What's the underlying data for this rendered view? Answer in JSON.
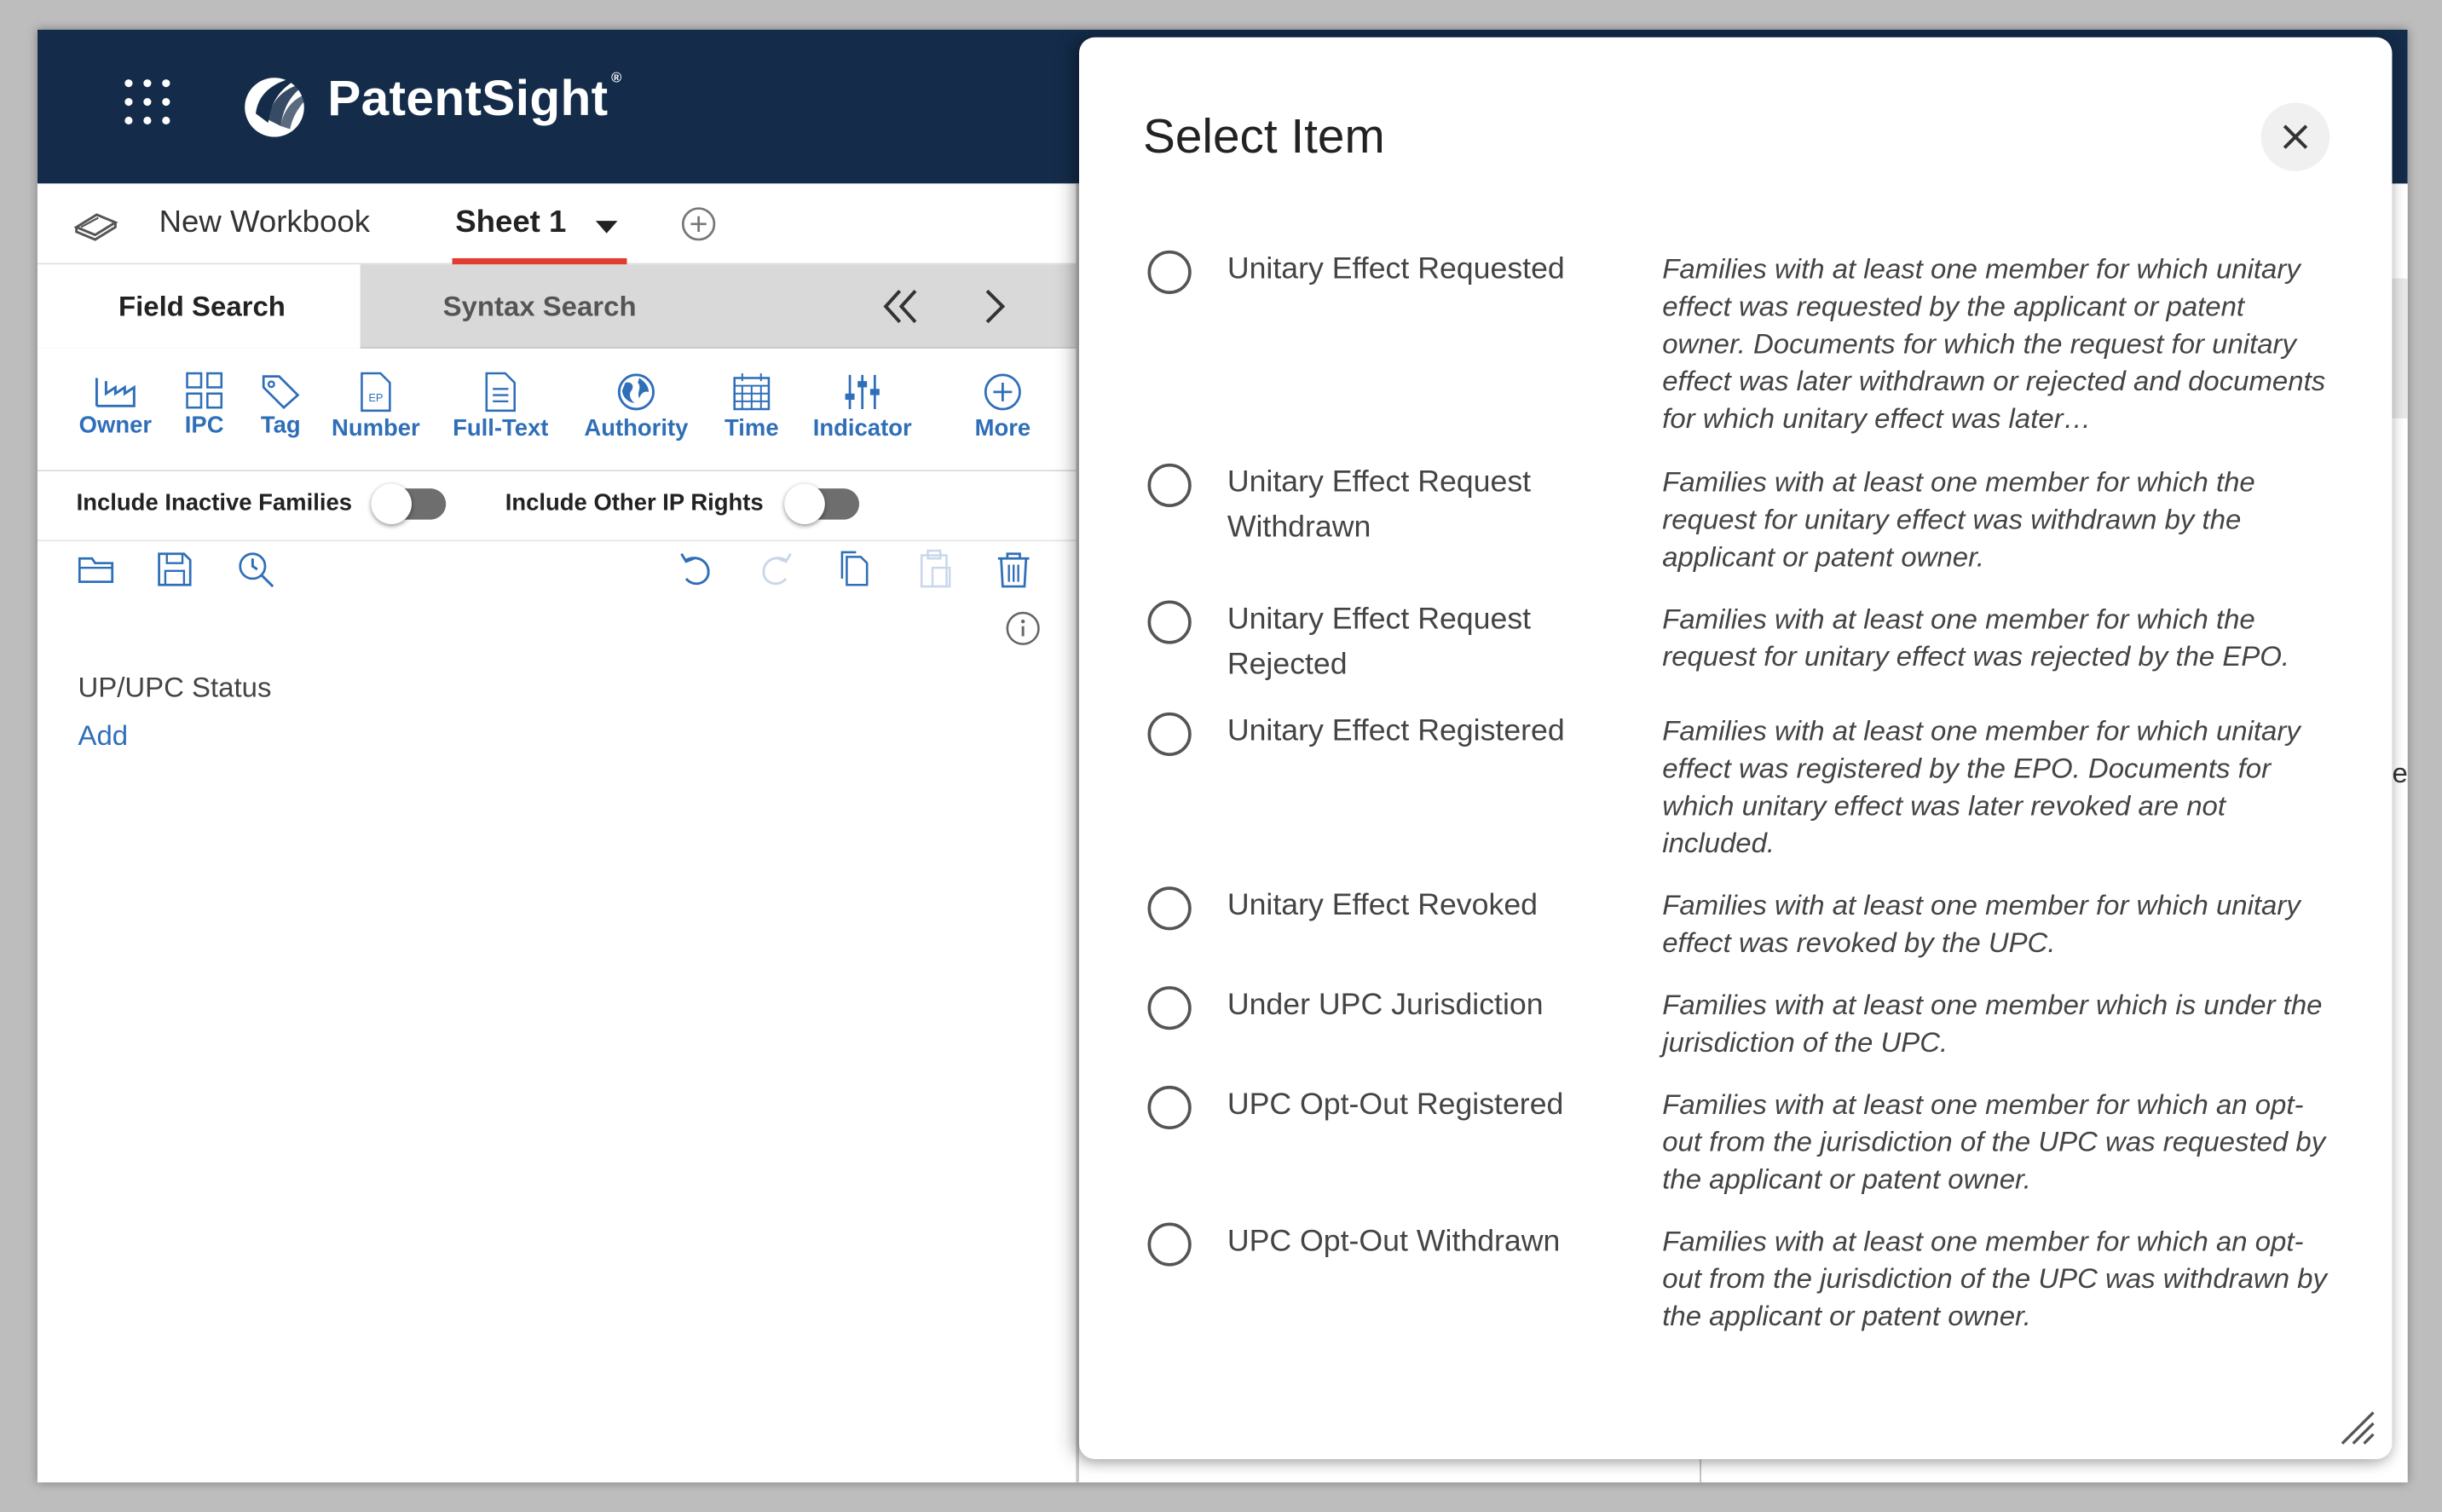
{
  "app": {
    "brand": "PatentSight",
    "brand_mark": "®"
  },
  "workbook": {
    "name": "New Workbook",
    "sheet": "Sheet 1"
  },
  "search_tabs": {
    "field": "Field Search",
    "syntax": "Syntax Search"
  },
  "field_toolbar": {
    "items": [
      {
        "label": "Owner",
        "icon": "factory-icon"
      },
      {
        "label": "IPC",
        "icon": "grid-squares-icon"
      },
      {
        "label": "Tag",
        "icon": "tag-icon"
      },
      {
        "label": "Number",
        "icon": "ep-document-icon"
      },
      {
        "label": "Full-Text",
        "icon": "text-document-icon"
      },
      {
        "label": "Authority",
        "icon": "globe-icon"
      },
      {
        "label": "Time",
        "icon": "calendar-icon"
      },
      {
        "label": "Indicator",
        "icon": "sliders-icon"
      },
      {
        "label": "More",
        "icon": "plus-circle-icon"
      }
    ]
  },
  "toggles": {
    "inactive": "Include Inactive Families",
    "other_ip": "Include Other IP Rights"
  },
  "query": {
    "field_label": "UP/UPC Status",
    "add_label": "Add"
  },
  "background": {
    "peek_letter": "e"
  },
  "modal": {
    "title": "Select Item",
    "options": [
      {
        "name": "Unitary Effect Requested",
        "desc": "Families with at least one member for which unitary effect was requested by the applicant or patent owner. Documents for which the request for unitary effect was later withdrawn or rejected and documents for which unitary effect was later…"
      },
      {
        "name": "Unitary Effect Request Withdrawn",
        "desc": "Families with at least one member for which the request for unitary effect was withdrawn by the applicant or patent owner."
      },
      {
        "name": "Unitary Effect Request Rejected",
        "desc": "Families with at least one member for which the request for unitary effect was rejected by the EPO."
      },
      {
        "name": "Unitary Effect Registered",
        "desc": "Families with at least one member for which unitary effect was registered by the EPO. Documents for which unitary effect was later revoked are not included."
      },
      {
        "name": "Unitary Effect Revoked",
        "desc": "Families with at least one member for which unitary effect was revoked by the UPC."
      },
      {
        "name": "Under UPC Jurisdiction",
        "desc": "Families with at least one member which is under the jurisdiction of the UPC."
      },
      {
        "name": "UPC Opt-Out Registered",
        "desc": "Families with at least one member for which an opt-out from the jurisdiction of the UPC was requested by the applicant or patent owner."
      },
      {
        "name": "UPC Opt-Out Withdrawn",
        "desc": "Families with at least one member for which an opt-out from the jurisdiction of the UPC was withdrawn by the applicant or patent owner."
      }
    ]
  },
  "colors": {
    "header_bg": "#142c4a",
    "accent_blue": "#2f6fb8",
    "tab_underline": "#e23b2f"
  }
}
